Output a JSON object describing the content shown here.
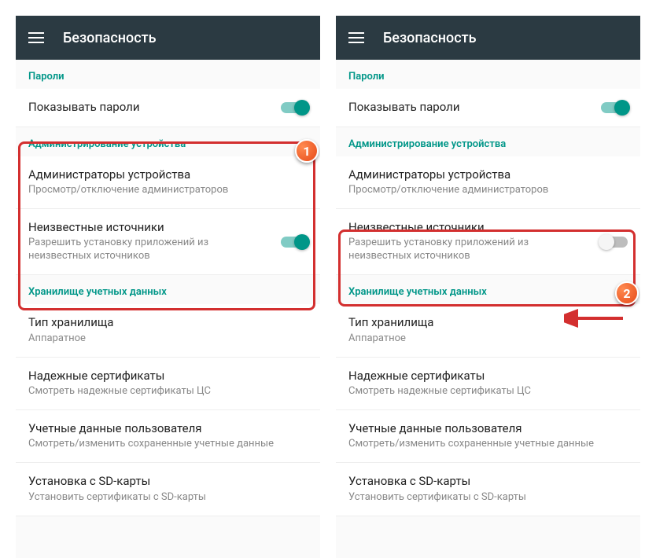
{
  "left": {
    "appTitle": "Безопасность",
    "sections": {
      "passwords": "Пароли",
      "admin": "Администрирование устройства",
      "storage": "Хранилище учетных данных"
    },
    "items": {
      "showPasswords": {
        "title": "Показывать пароли"
      },
      "deviceAdmins": {
        "title": "Администраторы устройства",
        "subtitle": "Просмотр/отключение администраторов"
      },
      "unknownSources": {
        "title": "Неизвестные источники",
        "subtitle": "Разрешить установку приложений из неизвестных источников"
      },
      "storageType": {
        "title": "Тип хранилища",
        "subtitle": "Аппаратное"
      },
      "trustedCerts": {
        "title": "Надежные сертификаты",
        "subtitle": "Смотреть надежные сертификаты ЦС"
      },
      "userCreds": {
        "title": "Учетные данные пользователя",
        "subtitle": "Смотреть/изменить сохраненные учетные данные"
      },
      "sdInstall": {
        "title": "Установка с SD-карты",
        "subtitle": "Установить сертификаты с SD-карты"
      }
    },
    "callout": "1"
  },
  "right": {
    "appTitle": "Безопасность",
    "sections": {
      "passwords": "Пароли",
      "admin": "Администрирование устройства",
      "storage": "Хранилище учетных данных"
    },
    "items": {
      "showPasswords": {
        "title": "Показывать пароли"
      },
      "deviceAdmins": {
        "title": "Администраторы устройства",
        "subtitle": "Просмотр/отключение администраторов"
      },
      "unknownSources": {
        "title": "Неизвестные источники",
        "subtitle": "Разрешить установку приложений из неизвестных источников"
      },
      "storageType": {
        "title": "Тип хранилища",
        "subtitle": "Аппаратное"
      },
      "trustedCerts": {
        "title": "Надежные сертификаты",
        "subtitle": "Смотреть надежные сертификаты ЦС"
      },
      "userCreds": {
        "title": "Учетные данные пользователя",
        "subtitle": "Смотреть/изменить сохраненные учетные данные"
      },
      "sdInstall": {
        "title": "Установка с SD-карты",
        "subtitle": "Установить сертификаты с SD-карты"
      }
    },
    "callout": "2"
  }
}
